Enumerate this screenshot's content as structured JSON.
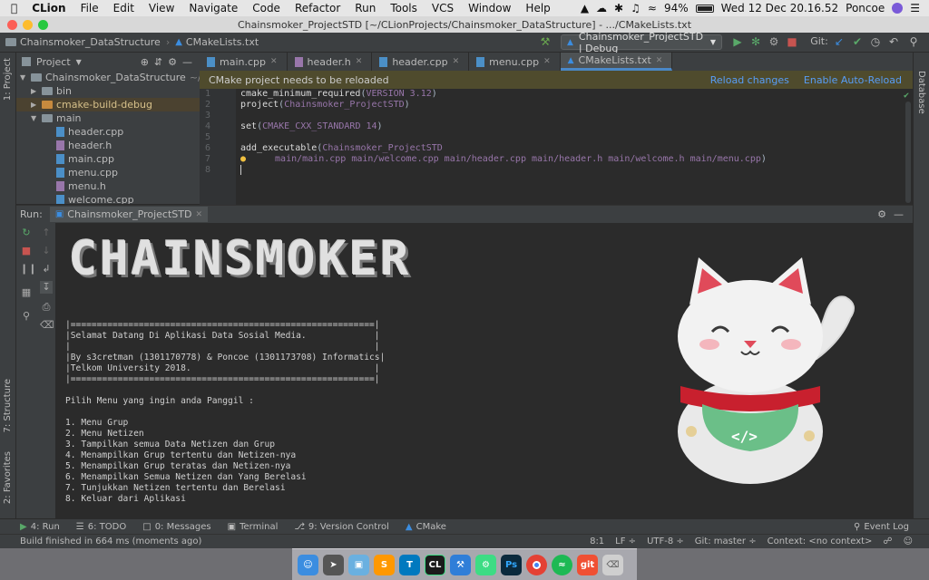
{
  "menubar": {
    "app": "CLion",
    "items": [
      "File",
      "Edit",
      "View",
      "Navigate",
      "Code",
      "Refactor",
      "Run",
      "Tools",
      "VCS",
      "Window",
      "Help"
    ],
    "battery": "94%",
    "datetime": "Wed 12 Dec  20.16.52",
    "user": "Poncoe"
  },
  "window": {
    "title": "Chainsmoker_ProjectSTD [~/CLionProjects/Chainsmoker_DataStructure] - .../CMakeLists.txt"
  },
  "navbar": {
    "project": "Chainsmoker_DataStructure",
    "file": "CMakeLists.txt",
    "run_config": "Chainsmoker_ProjectSTD | Debug",
    "git_label": "Git:"
  },
  "left_strip": {
    "project_tab": "1: Project",
    "structure_tab": "7: Structure",
    "favorites_tab": "2: Favorites"
  },
  "right_strip": {
    "database_tab": "Database"
  },
  "project_panel": {
    "header": "Project",
    "root": "Chainsmoker_DataStructure",
    "root_path": "~/CLi",
    "tree": [
      {
        "label": "bin",
        "type": "folder",
        "depth": 1,
        "expanded": false
      },
      {
        "label": "cmake-build-debug",
        "type": "folder-excluded",
        "depth": 1,
        "expanded": false
      },
      {
        "label": "main",
        "type": "folder",
        "depth": 1,
        "expanded": true
      },
      {
        "label": "header.cpp",
        "type": "cpp",
        "depth": 2
      },
      {
        "label": "header.h",
        "type": "h",
        "depth": 2
      },
      {
        "label": "main.cpp",
        "type": "cpp",
        "depth": 2
      },
      {
        "label": "menu.cpp",
        "type": "cpp",
        "depth": 2
      },
      {
        "label": "menu.h",
        "type": "h",
        "depth": 2
      },
      {
        "label": "welcome.cpp",
        "type": "cpp",
        "depth": 2
      }
    ]
  },
  "editor": {
    "tabs": [
      {
        "label": "main.cpp",
        "active": false
      },
      {
        "label": "header.h",
        "active": false
      },
      {
        "label": "header.cpp",
        "active": false
      },
      {
        "label": "menu.cpp",
        "active": false
      },
      {
        "label": "CMakeLists.txt",
        "active": true
      }
    ],
    "notification": "CMake project needs to be reloaded",
    "reload_link": "Reload changes",
    "auto_reload_link": "Enable Auto-Reload",
    "line_numbers": [
      "1",
      "2",
      "3",
      "4",
      "5",
      "6",
      "7",
      "8"
    ],
    "lines": {
      "l1_cmd": "cmake_minimum_required",
      "l1_open": "(",
      "l1_arg": "VERSION 3.12",
      "l1_close": ")",
      "l2_cmd": "project",
      "l2_open": "(",
      "l2_arg": "Chainsmoker_ProjectSTD",
      "l2_close": ")",
      "l4_cmd": "set",
      "l4_open": "(",
      "l4_arg": "CMAKE_CXX_STANDARD 14",
      "l4_close": ")",
      "l6_cmd": "add_executable",
      "l6_open": "(",
      "l6_arg": "Chainsmoker_ProjectSTD",
      "l7_args": "main/main.cpp main/welcome.cpp main/header.cpp main/header.h main/welcome.h main/menu.cpp",
      "l7_close": ")"
    }
  },
  "run_panel": {
    "label": "Run:",
    "tab": "Chainsmoker_ProjectSTD",
    "banner": "CHAINSMOKER",
    "console_lines": [
      "|==========================================================|",
      "|Selamat Datang Di Aplikasi Data Sosial Media.             |",
      "|                                                          |",
      "|By s3cretman (1301170778) & Poncoe (1301173708) Informatics|",
      "|Telkom University 2018.                                   |",
      "|==========================================================|",
      "",
      "Pilih Menu yang ingin anda Panggil :",
      "",
      "1. Menu Grup",
      "2. Menu Netizen",
      "3. Tampilkan semua Data Netizen dan Grup",
      "4. Menampilkan Grup tertentu dan Netizen-nya",
      "5. Menampilkan Grup teratas dan Netizen-nya",
      "6. Menampilkan Semua Netizen dan Yang Berelasi",
      "7. Tunjukkan Netizen tertentu dan Berelasi",
      "8. Keluar dari Aplikasi"
    ],
    "mascot_code": "</>"
  },
  "bottom_tabs": [
    {
      "label": "4: Run",
      "icon": "run-icon"
    },
    {
      "label": "6: TODO",
      "icon": "todo-icon"
    },
    {
      "label": "0: Messages",
      "icon": "messages-icon"
    },
    {
      "label": "Terminal",
      "icon": "terminal-icon"
    },
    {
      "label": "9: Version Control",
      "icon": "vcs-icon"
    },
    {
      "label": "CMake",
      "icon": "cmake-icon"
    }
  ],
  "event_log": "Event Log",
  "status": {
    "message": "Build finished in 664 ms (moments ago)",
    "position": "8:1",
    "line_sep": "LF ÷",
    "encoding": "UTF-8 ÷",
    "git_branch": "Git: master ÷",
    "context": "Context: <no context>"
  },
  "dock": [
    {
      "name": "finder",
      "label": "",
      "color": "#3b8de0"
    },
    {
      "name": "launchpad",
      "label": "",
      "color": "#555"
    },
    {
      "name": "virtualbox",
      "label": "",
      "color": "#6ab0e0"
    },
    {
      "name": "sublime",
      "label": "S",
      "color": "#ff9800"
    },
    {
      "name": "trello",
      "label": "T",
      "color": "#0079bf"
    },
    {
      "name": "clion",
      "label": "CL",
      "color": "#1b1b1b"
    },
    {
      "name": "xcode",
      "label": "",
      "color": "#2f7ed8"
    },
    {
      "name": "android-studio",
      "label": "",
      "color": "#3ddc84"
    },
    {
      "name": "photoshop",
      "label": "Ps",
      "color": "#0b2a3d"
    },
    {
      "name": "chrome",
      "label": "",
      "color": "#e44134"
    },
    {
      "name": "spotify",
      "label": "",
      "color": "#1db954"
    },
    {
      "name": "git",
      "label": "git",
      "color": "#f05033"
    },
    {
      "name": "trash",
      "label": "",
      "color": "#cfcfcf"
    }
  ]
}
